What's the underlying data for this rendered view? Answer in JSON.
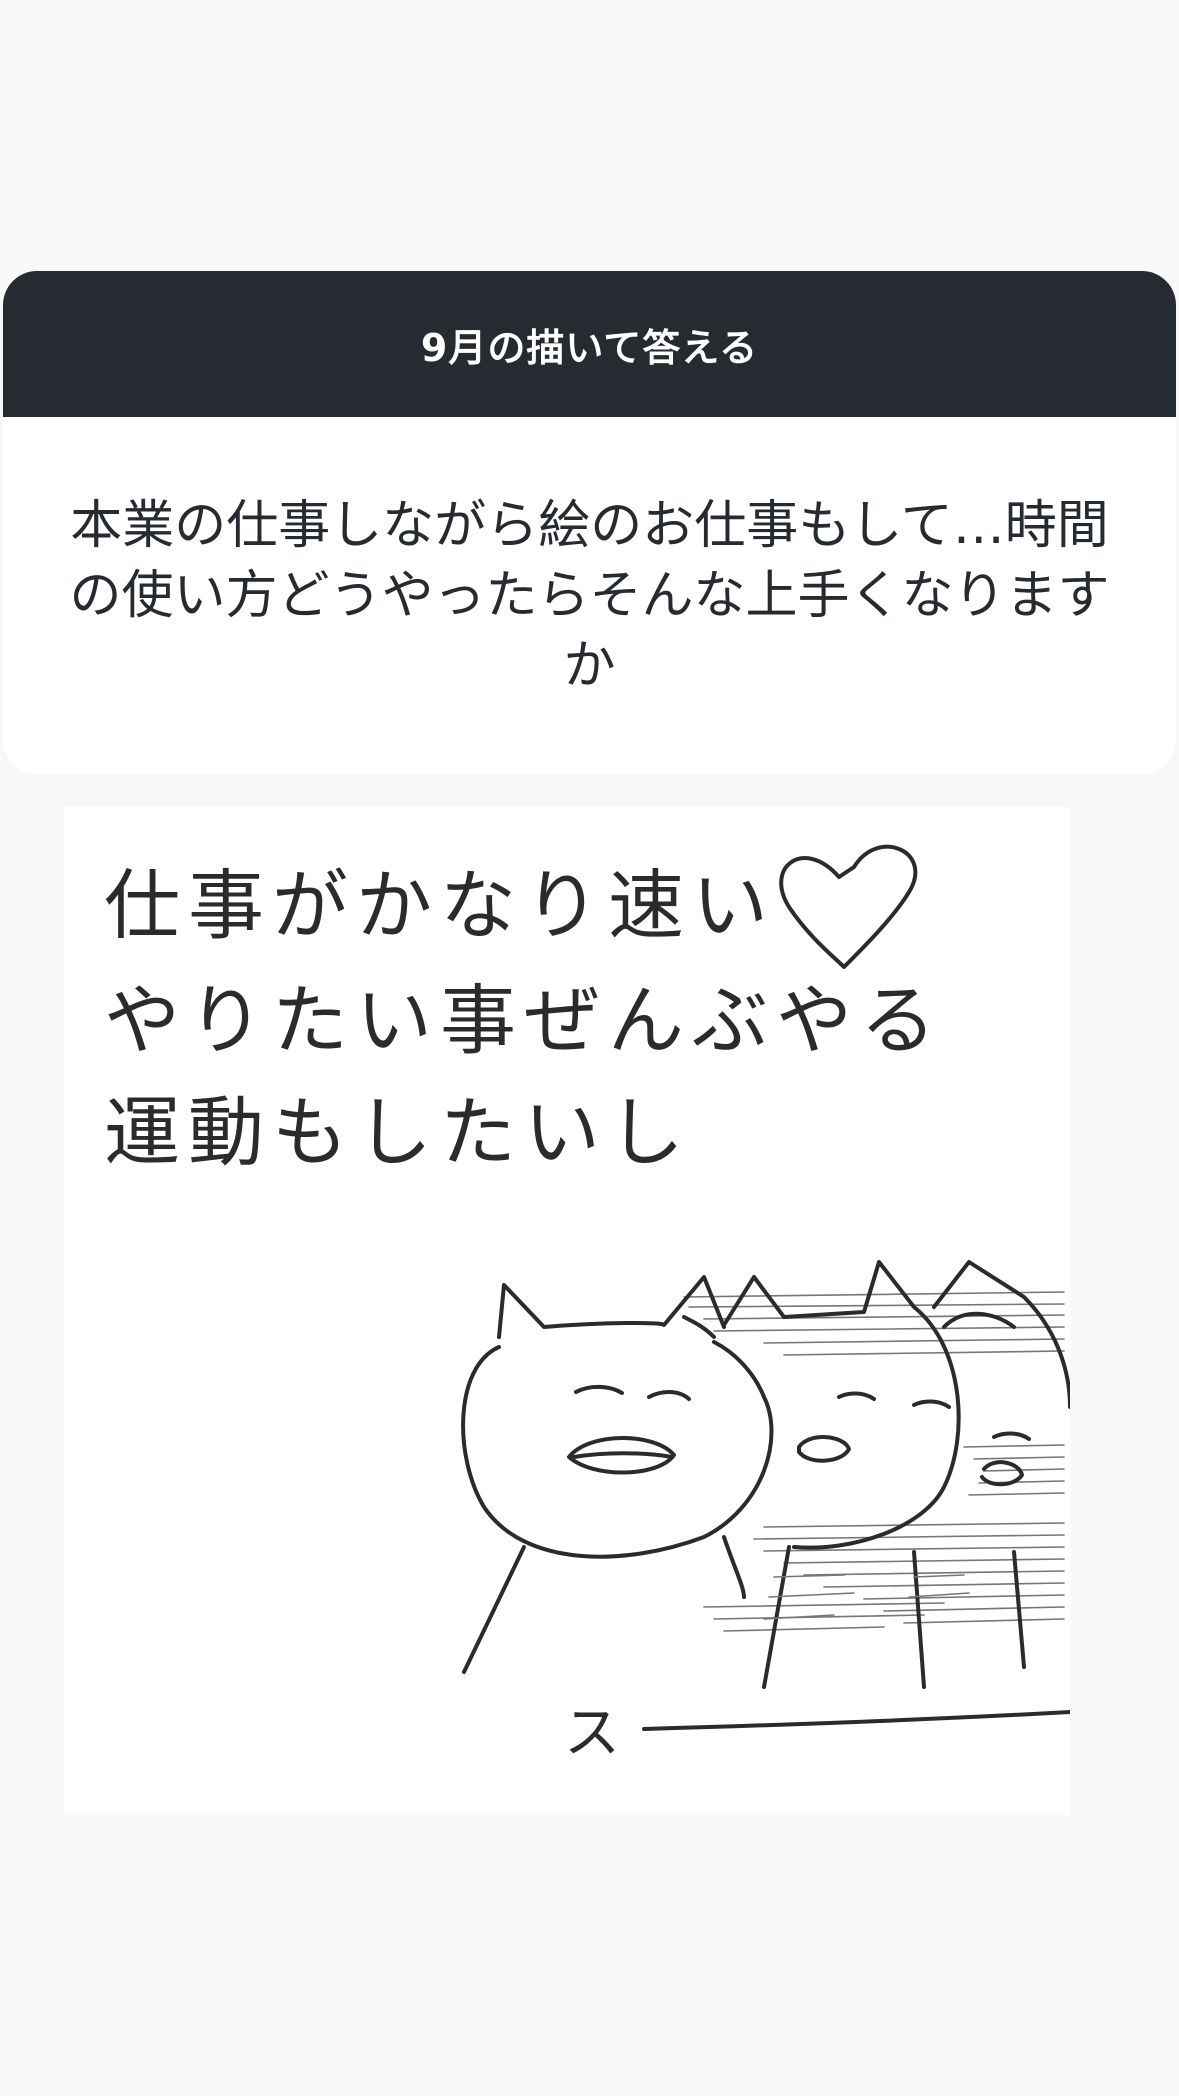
{
  "question_card": {
    "header_title": "9月の描いて答える",
    "question": "本業の仕事しながら絵のお仕事もして…時間の使い方どうやったらそんな上手くなりますか"
  },
  "answer_image": {
    "handwritten_lines": [
      "仕事がかなり速い",
      "やりたい事ぜんぶやる",
      "運動もしたいし"
    ],
    "sound_effect": "ス"
  }
}
